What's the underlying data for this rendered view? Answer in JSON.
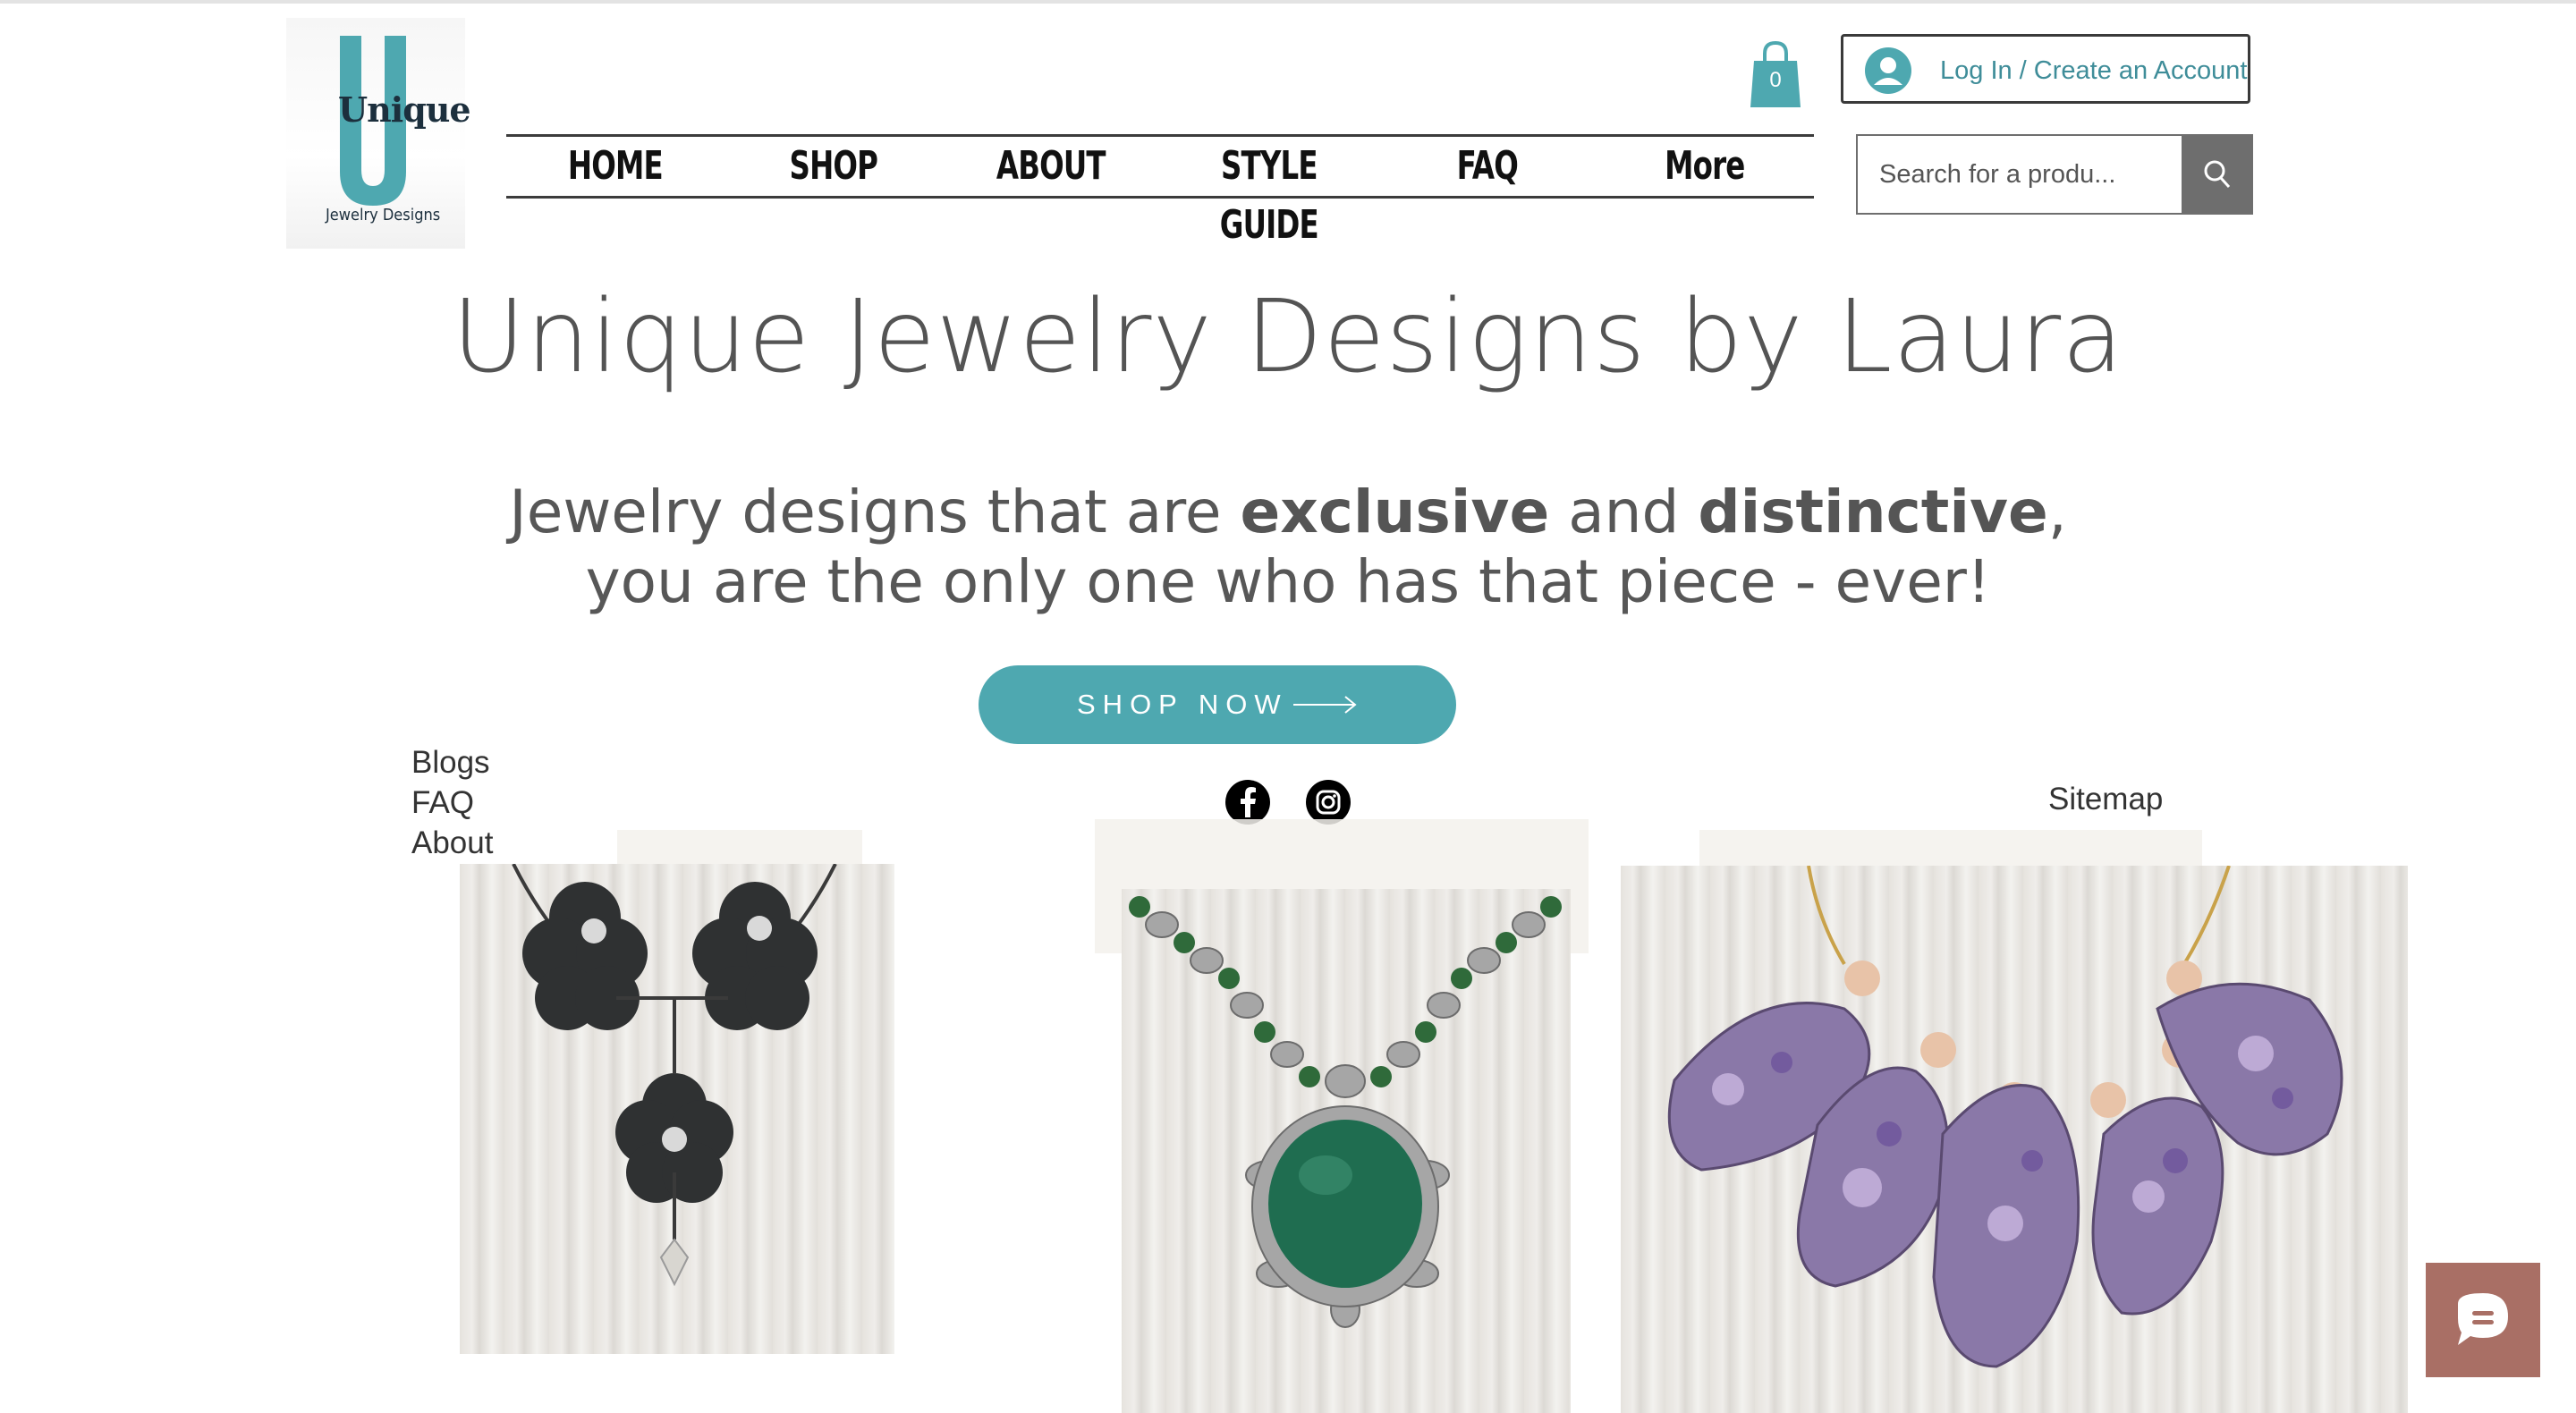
{
  "brand": {
    "logo_word": "Unique",
    "logo_sub": "Jewelry Designs",
    "logo_color": "#4ea8b0"
  },
  "nav": {
    "items": [
      "HOME",
      "SHOP",
      "ABOUT",
      "STYLE GUIDE",
      "FAQ",
      "More"
    ]
  },
  "cart": {
    "count": "0",
    "color": "#4ea8b0"
  },
  "account": {
    "login_label": "Log In / Create an Account"
  },
  "search": {
    "placeholder": "Search for a produ..."
  },
  "hero": {
    "title": "Unique Jewelry Designs by Laura",
    "tagline": {
      "part1": "Jewelry designs that are ",
      "bold1": "exclusive",
      "part2": " and ",
      "bold2": "distinctive",
      "part3": ",",
      "line2": "you are the only one who has that piece - ever!"
    },
    "shop_button": "SHOP NOW"
  },
  "footer_links": [
    "Blogs",
    "FAQ",
    "About"
  ],
  "sitemap_label": "Sitemap",
  "social": [
    "facebook-icon",
    "instagram-icon"
  ],
  "colors": {
    "accent": "#4ea8b0",
    "text": "#555555",
    "chat": "#a96f65"
  }
}
